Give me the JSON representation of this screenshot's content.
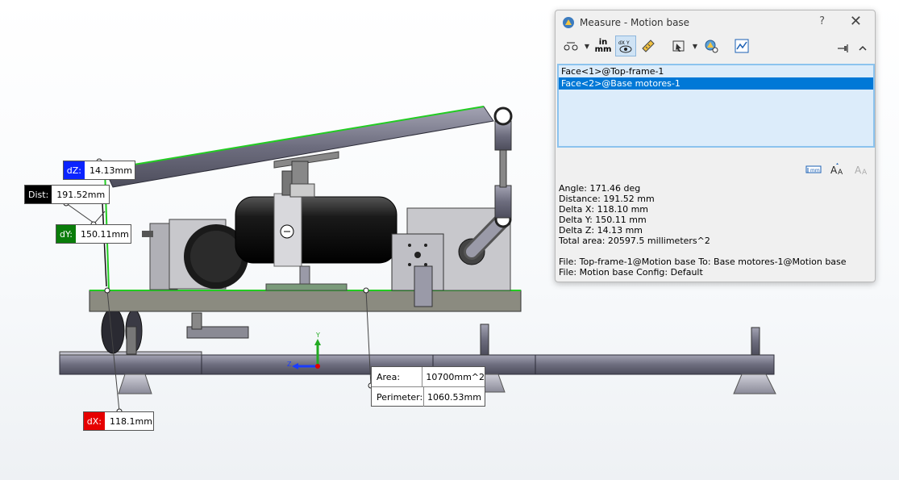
{
  "measure": {
    "title": "Measure - Motion base",
    "help_label": "?",
    "close_label": "✕",
    "toolbar": {
      "units_top": "in",
      "units_bottom": "mm"
    },
    "selections": [
      {
        "label": "Face<1>@Top-frame-1",
        "selected": false
      },
      {
        "label": "Face<2>@Base motores-1",
        "selected": true
      }
    ],
    "results": [
      "Angle: 171.46 deg",
      "Distance: 191.52 mm",
      "Delta X: 118.10 mm",
      "Delta Y: 150.11 mm",
      "Delta Z: 14.13 mm",
      "Total area: 20597.5 millimeters^2"
    ],
    "file_info": [
      "File: Top-frame-1@Motion base To: Base motores-1@Motion base",
      "File: Motion base Config: Default"
    ]
  },
  "callouts": {
    "dz": {
      "tag": "dZ:",
      "value": "14.13mm"
    },
    "dist": {
      "tag": "Dist:",
      "value": "191.52mm"
    },
    "dy": {
      "tag": "dY:",
      "value": "150.11mm"
    },
    "dx": {
      "tag": "dX:",
      "value": "118.1mm"
    }
  },
  "area_box": {
    "area_label": "Area:",
    "area_value": "10700mm^2",
    "perimeter_label": "Perimeter:",
    "perimeter_value": "1060.53mm"
  },
  "triad": {
    "y_label": "Y",
    "z_label": "Z"
  },
  "colors": {
    "frame": "#5d5d6e",
    "frame_light": "#9a9aa8",
    "motor": "#111111",
    "highlight_green": "#22cc22",
    "selection_blue": "#0078d7"
  }
}
